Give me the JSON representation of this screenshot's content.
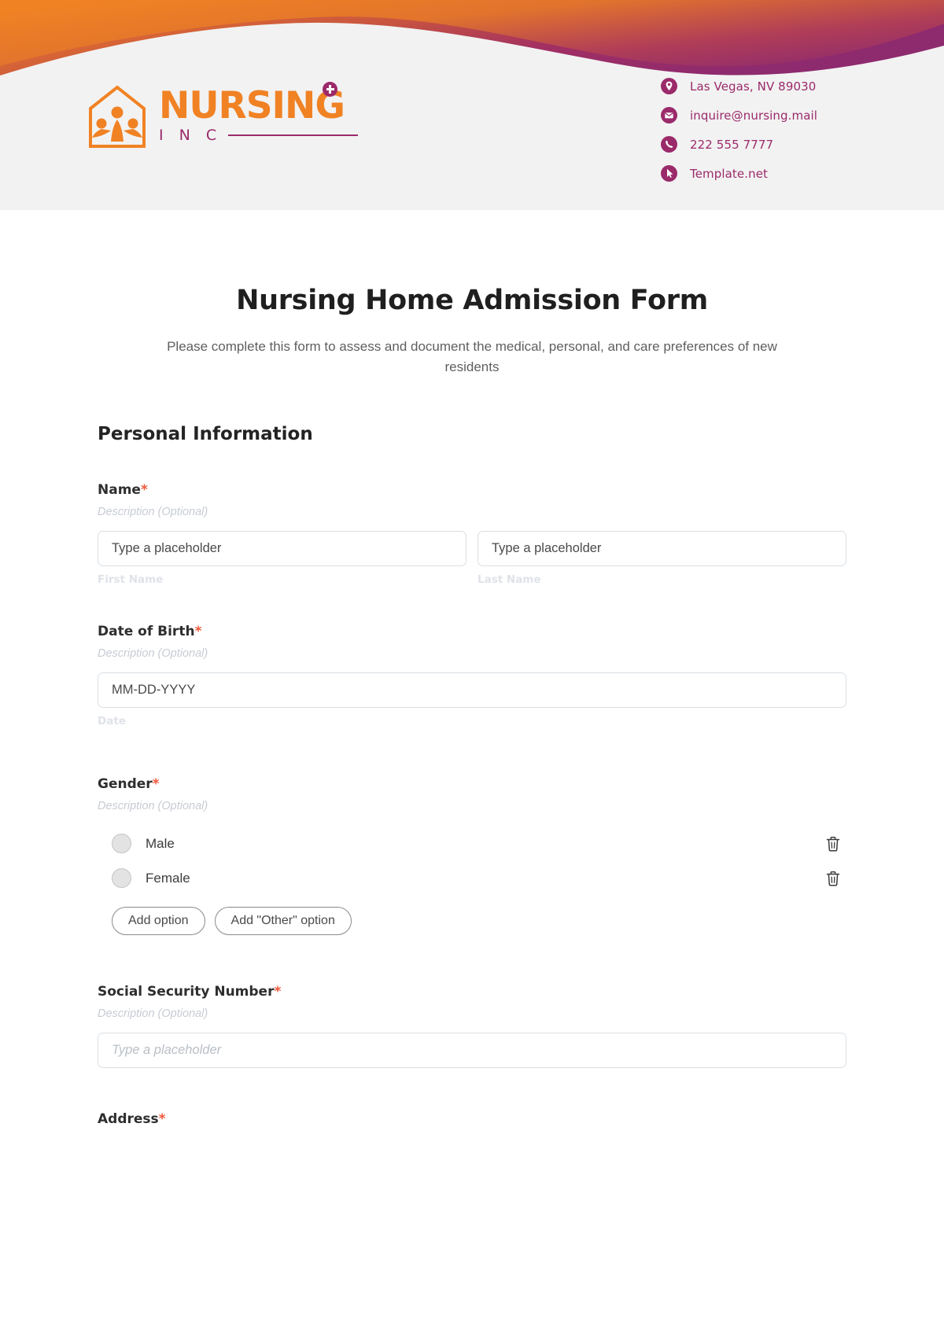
{
  "header": {
    "logo": {
      "word": "NURSING",
      "sub": "I N C",
      "cross_icon": "medical-cross-icon",
      "mark_icon": "nursing-home-people-icon"
    },
    "contacts": [
      {
        "icon": "location-pin-icon",
        "text": "Las Vegas, NV 89030"
      },
      {
        "icon": "envelope-icon",
        "text": "inquire@nursing.mail"
      },
      {
        "icon": "phone-icon",
        "text": "222 555 7777"
      },
      {
        "icon": "cursor-arrow-icon",
        "text": "Template.net"
      }
    ]
  },
  "form": {
    "title": "Nursing Home Admission Form",
    "subtitle": "Please complete this form to assess and document the medical, personal, and care preferences of new residents",
    "section_title": "Personal Information",
    "required_mark": "*",
    "description_placeholder": "Description (Optional)",
    "fields": {
      "name": {
        "label": "Name",
        "description": "Description (Optional)",
        "first_placeholder": "Type a placeholder",
        "last_placeholder": "Type a placeholder",
        "first_sublabel": "First Name",
        "last_sublabel": "Last Name"
      },
      "dob": {
        "label": "Date of Birth",
        "description": "Description (Optional)",
        "placeholder": "MM-DD-YYYY",
        "sublabel": "Date"
      },
      "gender": {
        "label": "Gender",
        "description": "Description (Optional)",
        "options": [
          {
            "label": "Male",
            "delete_icon": "trash-icon"
          },
          {
            "label": "Female",
            "delete_icon": "trash-icon"
          }
        ],
        "add_option_label": "Add option",
        "add_other_option_label": "Add \"Other\" option"
      },
      "ssn": {
        "label": "Social Security Number",
        "description": "Description (Optional)",
        "placeholder": "Type a placeholder"
      },
      "address": {
        "label": "Address"
      }
    }
  },
  "colors": {
    "orange": "#F08224",
    "magenta": "#9B2A6A",
    "required": "#f0563a",
    "header_bg": "#f2f2f2"
  }
}
